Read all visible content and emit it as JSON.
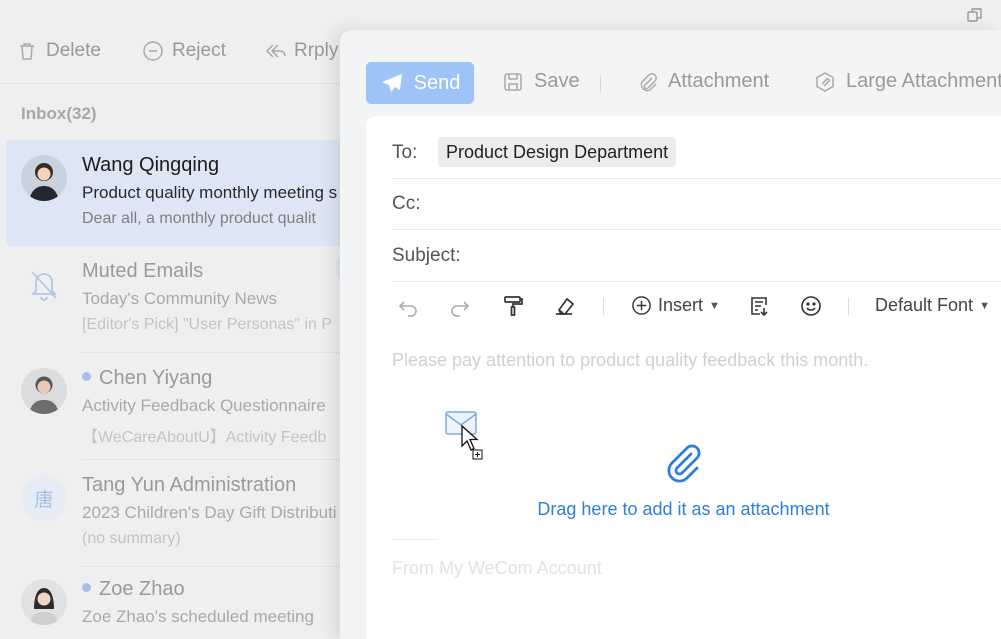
{
  "list_toolbar": {
    "delete_label": "Delete",
    "reject_label": "Reject",
    "reply_label": "Rrply"
  },
  "folder": {
    "label": "Inbox(32)"
  },
  "mail_list": [
    {
      "sender": "Wang Qingqing",
      "subject": "Product quality monthly meeting s",
      "summary": "Dear all,  a monthly product qualit",
      "unread": false
    },
    {
      "sender": "Muted Emails",
      "subject": "Today's Community News",
      "summary": "[Editor's Pick] \"User Personas\" in P",
      "unread": false
    },
    {
      "sender": "Chen Yiyang",
      "subject": "Activity Feedback Questionnaire",
      "summary": "【WeCareAboutU】Activity Feedb",
      "unread": true
    },
    {
      "sender": "Tang Yun Administration",
      "subject": "2023 Children's Day Gift Distributi",
      "summary": "(no summary)",
      "unread": false,
      "avatar_text": "唐"
    },
    {
      "sender": "Zoe Zhao",
      "subject": "Zoe Zhao's scheduled meeting",
      "summary": "",
      "unread": true
    }
  ],
  "compose_toolbar": {
    "send_label": "Send",
    "save_label": "Save",
    "attachment_label": "Attachment",
    "large_attachment_label": "Large Attachment"
  },
  "compose": {
    "to_label": "To:",
    "to_recipient": "Product Design Department",
    "cc_label": "Cc:",
    "subject_label": "Subject:",
    "insert_label": "Insert",
    "font_label": "Default Font",
    "body_placeholder": "Please pay attention to product quality feedback this month.",
    "drop_hint": "Drag here to add it as an attachment",
    "signature": "From My WeCom Account"
  },
  "colors": {
    "accent": "#2f7fd8",
    "send_button": "#9ec3f6",
    "selected_row": "#dde6f5",
    "unread_dot": "#a6bfe9"
  }
}
